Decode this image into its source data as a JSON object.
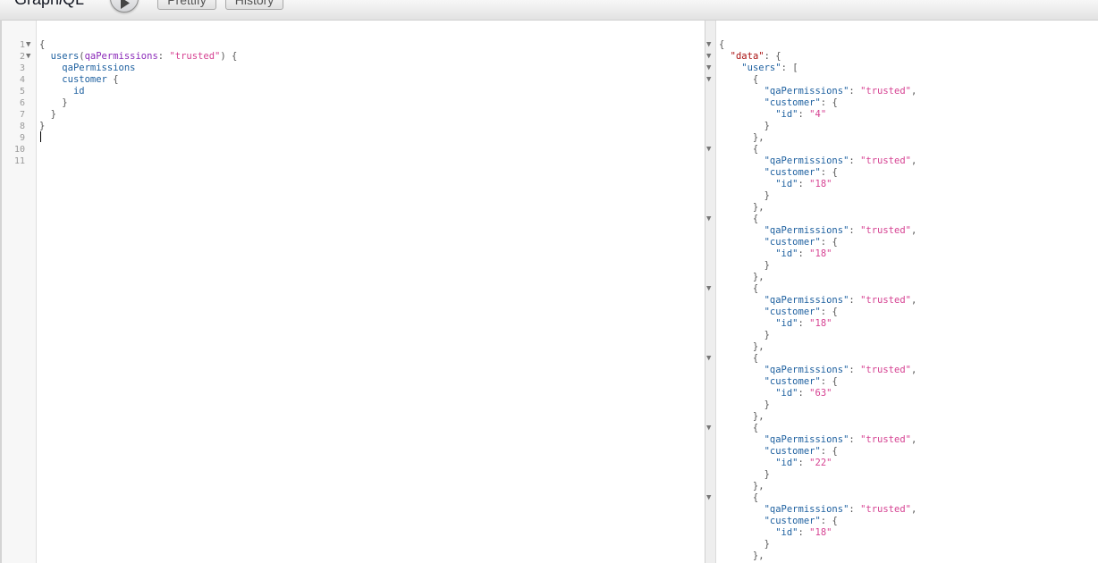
{
  "app": {
    "title_prefix": "Graph",
    "title_italic": "i",
    "title_suffix": "QL"
  },
  "toolbar": {
    "execute_icon": "play-icon",
    "prettify_label": "Prettify",
    "history_label": "History"
  },
  "query": {
    "line_numbers": [
      "1",
      "2",
      "3",
      "4",
      "5",
      "6",
      "7",
      "8",
      "9",
      "10",
      "11"
    ],
    "foldable_lines": [
      1,
      2
    ],
    "lines": [
      [
        {
          "t": "{",
          "c": "p"
        }
      ],
      [
        {
          "t": "  ",
          "c": "p"
        },
        {
          "t": "users",
          "c": "f"
        },
        {
          "t": "(",
          "c": "p"
        },
        {
          "t": "qaPermissions",
          "c": "a"
        },
        {
          "t": ": ",
          "c": "p"
        },
        {
          "t": "\"trusted\"",
          "c": "s"
        },
        {
          "t": ") {",
          "c": "p"
        }
      ],
      [
        {
          "t": "    ",
          "c": "p"
        },
        {
          "t": "qaPermissions",
          "c": "f"
        }
      ],
      [
        {
          "t": "    ",
          "c": "p"
        },
        {
          "t": "customer",
          "c": "f"
        },
        {
          "t": " {",
          "c": "p"
        }
      ],
      [
        {
          "t": "      ",
          "c": "p"
        },
        {
          "t": "id",
          "c": "f"
        }
      ],
      [
        {
          "t": "    }",
          "c": "p"
        }
      ],
      [
        {
          "t": "  }",
          "c": "p"
        }
      ],
      [
        {
          "t": "}",
          "c": "p"
        }
      ],
      [],
      [],
      []
    ]
  },
  "result": {
    "lines": [
      [
        {
          "t": "{",
          "c": "p"
        }
      ],
      [
        {
          "t": "  ",
          "c": "p"
        },
        {
          "t": "\"data\"",
          "c": "dk"
        },
        {
          "t": ": {",
          "c": "p"
        }
      ],
      [
        {
          "t": "    ",
          "c": "p"
        },
        {
          "t": "\"users\"",
          "c": "k"
        },
        {
          "t": ": [",
          "c": "p"
        }
      ],
      [
        {
          "t": "      {",
          "c": "p"
        }
      ],
      [
        {
          "t": "        ",
          "c": "p"
        },
        {
          "t": "\"qaPermissions\"",
          "c": "k"
        },
        {
          "t": ": ",
          "c": "p"
        },
        {
          "t": "\"trusted\"",
          "c": "s"
        },
        {
          "t": ",",
          "c": "p"
        }
      ],
      [
        {
          "t": "        ",
          "c": "p"
        },
        {
          "t": "\"customer\"",
          "c": "k"
        },
        {
          "t": ": {",
          "c": "p"
        }
      ],
      [
        {
          "t": "          ",
          "c": "p"
        },
        {
          "t": "\"id\"",
          "c": "k"
        },
        {
          "t": ": ",
          "c": "p"
        },
        {
          "t": "\"4\"",
          "c": "s"
        }
      ],
      [
        {
          "t": "        }",
          "c": "p"
        }
      ],
      [
        {
          "t": "      },",
          "c": "p"
        }
      ],
      [
        {
          "t": "      {",
          "c": "p"
        }
      ],
      [
        {
          "t": "        ",
          "c": "p"
        },
        {
          "t": "\"qaPermissions\"",
          "c": "k"
        },
        {
          "t": ": ",
          "c": "p"
        },
        {
          "t": "\"trusted\"",
          "c": "s"
        },
        {
          "t": ",",
          "c": "p"
        }
      ],
      [
        {
          "t": "        ",
          "c": "p"
        },
        {
          "t": "\"customer\"",
          "c": "k"
        },
        {
          "t": ": {",
          "c": "p"
        }
      ],
      [
        {
          "t": "          ",
          "c": "p"
        },
        {
          "t": "\"id\"",
          "c": "k"
        },
        {
          "t": ": ",
          "c": "p"
        },
        {
          "t": "\"18\"",
          "c": "s"
        }
      ],
      [
        {
          "t": "        }",
          "c": "p"
        }
      ],
      [
        {
          "t": "      },",
          "c": "p"
        }
      ],
      [
        {
          "t": "      {",
          "c": "p"
        }
      ],
      [
        {
          "t": "        ",
          "c": "p"
        },
        {
          "t": "\"qaPermissions\"",
          "c": "k"
        },
        {
          "t": ": ",
          "c": "p"
        },
        {
          "t": "\"trusted\"",
          "c": "s"
        },
        {
          "t": ",",
          "c": "p"
        }
      ],
      [
        {
          "t": "        ",
          "c": "p"
        },
        {
          "t": "\"customer\"",
          "c": "k"
        },
        {
          "t": ": {",
          "c": "p"
        }
      ],
      [
        {
          "t": "          ",
          "c": "p"
        },
        {
          "t": "\"id\"",
          "c": "k"
        },
        {
          "t": ": ",
          "c": "p"
        },
        {
          "t": "\"18\"",
          "c": "s"
        }
      ],
      [
        {
          "t": "        }",
          "c": "p"
        }
      ],
      [
        {
          "t": "      },",
          "c": "p"
        }
      ],
      [
        {
          "t": "      {",
          "c": "p"
        }
      ],
      [
        {
          "t": "        ",
          "c": "p"
        },
        {
          "t": "\"qaPermissions\"",
          "c": "k"
        },
        {
          "t": ": ",
          "c": "p"
        },
        {
          "t": "\"trusted\"",
          "c": "s"
        },
        {
          "t": ",",
          "c": "p"
        }
      ],
      [
        {
          "t": "        ",
          "c": "p"
        },
        {
          "t": "\"customer\"",
          "c": "k"
        },
        {
          "t": ": {",
          "c": "p"
        }
      ],
      [
        {
          "t": "          ",
          "c": "p"
        },
        {
          "t": "\"id\"",
          "c": "k"
        },
        {
          "t": ": ",
          "c": "p"
        },
        {
          "t": "\"18\"",
          "c": "s"
        }
      ],
      [
        {
          "t": "        }",
          "c": "p"
        }
      ],
      [
        {
          "t": "      },",
          "c": "p"
        }
      ],
      [
        {
          "t": "      {",
          "c": "p"
        }
      ],
      [
        {
          "t": "        ",
          "c": "p"
        },
        {
          "t": "\"qaPermissions\"",
          "c": "k"
        },
        {
          "t": ": ",
          "c": "p"
        },
        {
          "t": "\"trusted\"",
          "c": "s"
        },
        {
          "t": ",",
          "c": "p"
        }
      ],
      [
        {
          "t": "        ",
          "c": "p"
        },
        {
          "t": "\"customer\"",
          "c": "k"
        },
        {
          "t": ": {",
          "c": "p"
        }
      ],
      [
        {
          "t": "          ",
          "c": "p"
        },
        {
          "t": "\"id\"",
          "c": "k"
        },
        {
          "t": ": ",
          "c": "p"
        },
        {
          "t": "\"63\"",
          "c": "s"
        }
      ],
      [
        {
          "t": "        }",
          "c": "p"
        }
      ],
      [
        {
          "t": "      },",
          "c": "p"
        }
      ],
      [
        {
          "t": "      {",
          "c": "p"
        }
      ],
      [
        {
          "t": "        ",
          "c": "p"
        },
        {
          "t": "\"qaPermissions\"",
          "c": "k"
        },
        {
          "t": ": ",
          "c": "p"
        },
        {
          "t": "\"trusted\"",
          "c": "s"
        },
        {
          "t": ",",
          "c": "p"
        }
      ],
      [
        {
          "t": "        ",
          "c": "p"
        },
        {
          "t": "\"customer\"",
          "c": "k"
        },
        {
          "t": ": {",
          "c": "p"
        }
      ],
      [
        {
          "t": "          ",
          "c": "p"
        },
        {
          "t": "\"id\"",
          "c": "k"
        },
        {
          "t": ": ",
          "c": "p"
        },
        {
          "t": "\"22\"",
          "c": "s"
        }
      ],
      [
        {
          "t": "        }",
          "c": "p"
        }
      ],
      [
        {
          "t": "      },",
          "c": "p"
        }
      ],
      [
        {
          "t": "      {",
          "c": "p"
        }
      ],
      [
        {
          "t": "        ",
          "c": "p"
        },
        {
          "t": "\"qaPermissions\"",
          "c": "k"
        },
        {
          "t": ": ",
          "c": "p"
        },
        {
          "t": "\"trusted\"",
          "c": "s"
        },
        {
          "t": ",",
          "c": "p"
        }
      ],
      [
        {
          "t": "        ",
          "c": "p"
        },
        {
          "t": "\"customer\"",
          "c": "k"
        },
        {
          "t": ": {",
          "c": "p"
        }
      ],
      [
        {
          "t": "          ",
          "c": "p"
        },
        {
          "t": "\"id\"",
          "c": "k"
        },
        {
          "t": ": ",
          "c": "p"
        },
        {
          "t": "\"18\"",
          "c": "s"
        }
      ],
      [
        {
          "t": "        }",
          "c": "p"
        }
      ],
      [
        {
          "t": "      },",
          "c": "p"
        }
      ]
    ],
    "foldable_lines": [
      1,
      2,
      3,
      4,
      10,
      16,
      22,
      28,
      34,
      40
    ]
  },
  "colors": {
    "key": "#1f61a0",
    "string": "#d64292",
    "argument": "#8b2bb9",
    "data_key": "#aa1111"
  }
}
